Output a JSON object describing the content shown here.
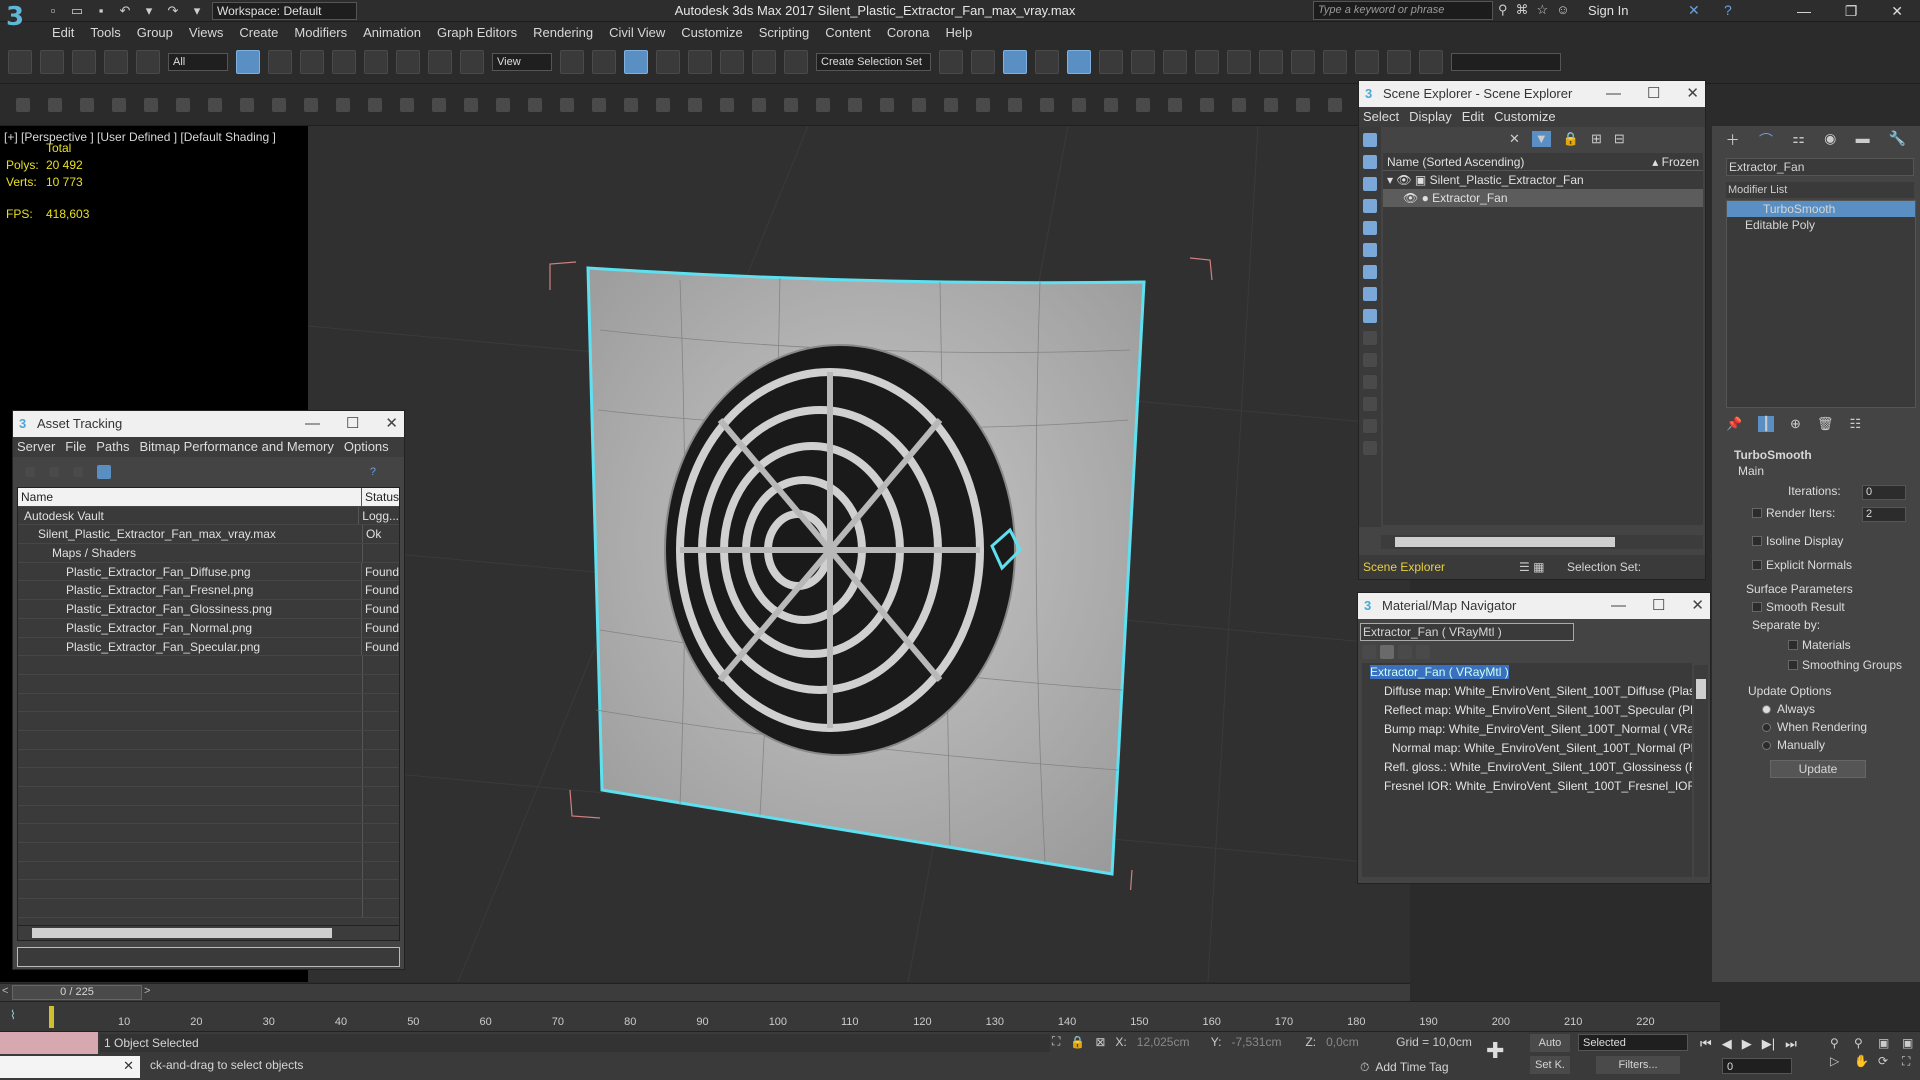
{
  "title_bar": {
    "logo": "3",
    "workspace": "Workspace: Default",
    "window_title": "Autodesk 3ds Max 2017     Silent_Plastic_Extractor_Fan_max_vray.max",
    "search_placeholder": "Type a keyword or phrase",
    "sign_in": "Sign In"
  },
  "menu": [
    "Edit",
    "Tools",
    "Group",
    "Views",
    "Create",
    "Modifiers",
    "Animation",
    "Graph Editors",
    "Rendering",
    "Civil View",
    "Customize",
    "Scripting",
    "Content",
    "Corona",
    "Help"
  ],
  "toolbar": {
    "filter_all": "All",
    "view_dropdown": "View",
    "selection_set": "Create Selection Set"
  },
  "viewport": {
    "label": "[+] [Perspective ] [User Defined ] [Default Shading ]",
    "stats_total": "Total",
    "polys_label": "Polys:",
    "polys_value": "20 492",
    "verts_label": "Verts:",
    "verts_value": "10 773",
    "fps_label": "FPS:",
    "fps_value": "418,603"
  },
  "asset_tracking": {
    "title": "Asset Tracking",
    "menu": [
      "Server",
      "File",
      "Paths",
      "Bitmap Performance and Memory",
      "Options"
    ],
    "col_name": "Name",
    "col_status": "Status",
    "rows": [
      {
        "name": "Autodesk Vault",
        "status": "Logg...",
        "indent": 0
      },
      {
        "name": "Silent_Plastic_Extractor_Fan_max_vray.max",
        "status": "Ok",
        "indent": 1
      },
      {
        "name": "Maps / Shaders",
        "status": "",
        "indent": 2
      },
      {
        "name": "Plastic_Extractor_Fan_Diffuse.png",
        "status": "Found",
        "indent": 3
      },
      {
        "name": "Plastic_Extractor_Fan_Fresnel.png",
        "status": "Found",
        "indent": 3
      },
      {
        "name": "Plastic_Extractor_Fan_Glossiness.png",
        "status": "Found",
        "indent": 3
      },
      {
        "name": "Plastic_Extractor_Fan_Normal.png",
        "status": "Found",
        "indent": 3
      },
      {
        "name": "Plastic_Extractor_Fan_Specular.png",
        "status": "Found",
        "indent": 3
      }
    ]
  },
  "scene_explorer": {
    "title": "Scene Explorer - Scene Explorer",
    "menu": [
      "Select",
      "Display",
      "Edit",
      "Customize"
    ],
    "col_name": "Name (Sorted Ascending)",
    "col_frozen": "▴ Frozen",
    "items": [
      "Silent_Plastic_Extractor_Fan",
      "Extractor_Fan"
    ],
    "footer_name": "Scene Explorer",
    "selection_set": "Selection Set:"
  },
  "material_nav": {
    "title": "Material/Map Navigator",
    "current": "Extractor_Fan  ( VRayMtl )",
    "items": [
      "Extractor_Fan  ( VRayMtl )",
      "Diffuse map: White_EnviroVent_Silent_100T_Diffuse (Plastic_E",
      "Reflect map: White_EnviroVent_Silent_100T_Specular (Plastic_",
      "Bump map: White_EnviroVent_Silent_100T_Normal  ( VRayNo",
      "Normal map: White_EnviroVent_Silent_100T_Normal (Plastic",
      "Refl. gloss.: White_EnviroVent_Silent_100T_Glossiness (Plastic",
      "Fresnel IOR: White_EnviroVent_Silent_100T_Fresnel_IOR (Plas"
    ]
  },
  "command_panel": {
    "object_name": "Extractor_Fan",
    "modifier_list": "Modifier List",
    "stack": [
      "TurboSmooth",
      "Editable Poly"
    ],
    "rollout": "TurboSmooth",
    "main": "Main",
    "iterations_label": "Iterations:",
    "iterations": "0",
    "render_iters_label": "Render Iters:",
    "render_iters": "2",
    "isoline": "Isoline Display",
    "explicit": "Explicit Normals",
    "surface": "Surface Parameters",
    "smooth": "Smooth Result",
    "separate": "Separate by:",
    "materials": "Materials",
    "smoothing_groups": "Smoothing Groups",
    "update_options": "Update Options",
    "always": "Always",
    "when_rendering": "When Rendering",
    "manually": "Manually",
    "update_btn": "Update"
  },
  "timeline": {
    "frame": "0 / 225",
    "ticks": [
      "10",
      "20",
      "30",
      "40",
      "50",
      "60",
      "70",
      "80",
      "90",
      "100",
      "110",
      "120",
      "130",
      "140",
      "150",
      "160",
      "170",
      "180",
      "190",
      "200",
      "210",
      "220"
    ]
  },
  "status": {
    "selected": "1 Object Selected",
    "prompt": "ck-and-drag to select objects",
    "x_label": "X:",
    "x_value": "12,025cm",
    "y_label": "Y:",
    "y_value": "-7,531cm",
    "z_label": "Z:",
    "z_value": "0,0cm",
    "grid": "Grid = 10,0cm",
    "add_time_tag": "Add Time Tag",
    "auto": "Auto",
    "set_key": "Set K.",
    "selected_dd": "Selected",
    "filters": "Filters...",
    "frame_spin": "0"
  }
}
